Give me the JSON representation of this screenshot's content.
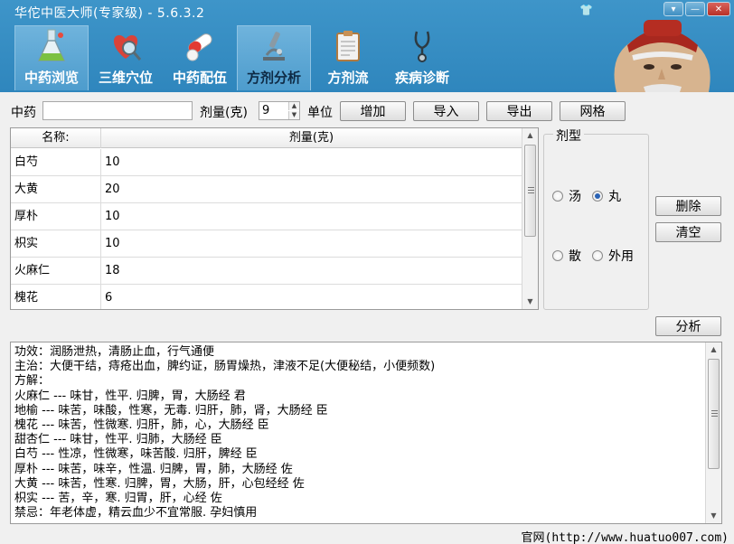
{
  "window": {
    "title": "华佗中医大师(专家级) - 5.6.3.2",
    "controls": {
      "menu": "▾",
      "minimize": "—",
      "close": "✕"
    }
  },
  "tabs": [
    {
      "label": "中药浏览",
      "icon": "flask-icon",
      "active": true
    },
    {
      "label": "三维穴位",
      "icon": "heart-magnifier-icon",
      "active": false
    },
    {
      "label": "中药配伍",
      "icon": "pills-icon",
      "active": false
    },
    {
      "label": "方剂分析",
      "icon": "microscope-icon",
      "active": true
    },
    {
      "label": "方剂流",
      "icon": "clipboard-icon",
      "active": false
    },
    {
      "label": "疾病诊断",
      "icon": "stethoscope-icon",
      "active": false
    }
  ],
  "entry": {
    "herb_label": "中药",
    "herb_value": "",
    "dose_label": "剂量(克)",
    "dose_value": "9",
    "unit_label": "单位",
    "buttons": {
      "add": "增加",
      "import": "导入",
      "export": "导出",
      "grid": "网格"
    }
  },
  "grid": {
    "columns": [
      "名称:",
      "剂量(克)"
    ],
    "rows": [
      {
        "name": "白芍",
        "dose": "10"
      },
      {
        "name": "大黄",
        "dose": "20"
      },
      {
        "name": "厚朴",
        "dose": "10"
      },
      {
        "name": "枳实",
        "dose": "10"
      },
      {
        "name": "火麻仁",
        "dose": "18"
      },
      {
        "name": "槐花",
        "dose": "6"
      }
    ]
  },
  "form_type": {
    "title": "剂型",
    "options": [
      {
        "label": "汤",
        "checked": false
      },
      {
        "label": "丸",
        "checked": true
      },
      {
        "label": "散",
        "checked": false
      },
      {
        "label": "外用",
        "checked": false
      }
    ]
  },
  "side_buttons": {
    "delete": "删除",
    "clear": "清空",
    "analyze": "分析"
  },
  "analysis_text": [
    "功效：润肠泄热，清肠止血，行气通便",
    "主治：大便干结，痔疮出血，脾约证，肠胃燥热，津液不足(大便秘结，小便频数)",
    "方解：",
    "火麻仁 --- 味甘，性平. 归脾，胃，大肠经 君",
    "地榆 --- 味苦，味酸，性寒，无毒. 归肝，肺，肾，大肠经 臣",
    "槐花 --- 味苦，性微寒. 归肝，肺，心，大肠经 臣",
    "甜杏仁 --- 味甘，性平. 归肺，大肠经 臣",
    "白芍 --- 性凉，性微寒，味苦酸. 归肝，脾经 臣",
    "厚朴 --- 味苦，味辛，性温. 归脾，胃，肺，大肠经 佐",
    "大黄 --- 味苦，性寒. 归脾，胃，大肠，肝，心包经经 佐",
    "枳实 --- 苦，辛，寒. 归胃，肝，心经 佐",
    "禁忌：年老体虚，精云血少不宜常服. 孕妇慎用"
  ],
  "status": {
    "website": "官网(http://www.huatuo007.com)"
  }
}
